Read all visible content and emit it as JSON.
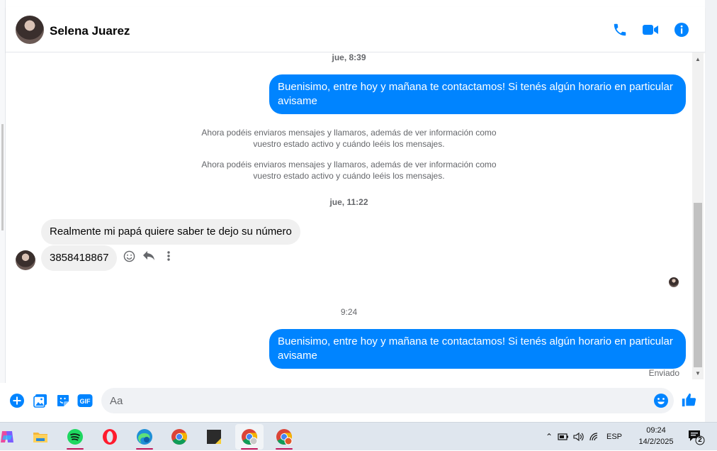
{
  "header": {
    "contact_name": "Selena Juarez",
    "icons": [
      "phone-icon",
      "video-camera-icon",
      "info-icon"
    ]
  },
  "accent_color": "#0084ff",
  "chat": {
    "timestamp_1": "jue, 8:39",
    "outgoing_1": "Buenisimo, entre hoy y mañana te contactamos! Si tenés algún horario en particular avisame",
    "system_1_line1": "Ahora podéis enviaros mensajes y llamaros, además de ver información como",
    "system_1_line2": "vuestro estado activo y cuándo leéis los mensajes.",
    "system_2_line1": "Ahora podéis enviaros mensajes y llamaros, además de ver información como",
    "system_2_line2": "vuestro estado activo y cuándo leéis los mensajes.",
    "timestamp_2": "jue, 11:22",
    "incoming_1": "Realmente mi papá quiere saber te dejo su número",
    "incoming_2": "3858418867",
    "timestamp_3": "9:24",
    "outgoing_2": "Buenisimo, entre hoy y mañana te contactamos! Si tenés algún horario en particular avisame",
    "status": "Enviado"
  },
  "composer": {
    "placeholder": "Aa",
    "value": "",
    "gif_label": "GIF"
  },
  "taskbar": {
    "apps": [
      "copilot",
      "file-explorer",
      "spotify",
      "opera",
      "edge",
      "chrome",
      "sticky-notes",
      "chrome-profile-1",
      "chrome-profile-2"
    ],
    "language": "ESP",
    "time": "09:24",
    "date": "14/2/2025",
    "notifications": "2"
  }
}
